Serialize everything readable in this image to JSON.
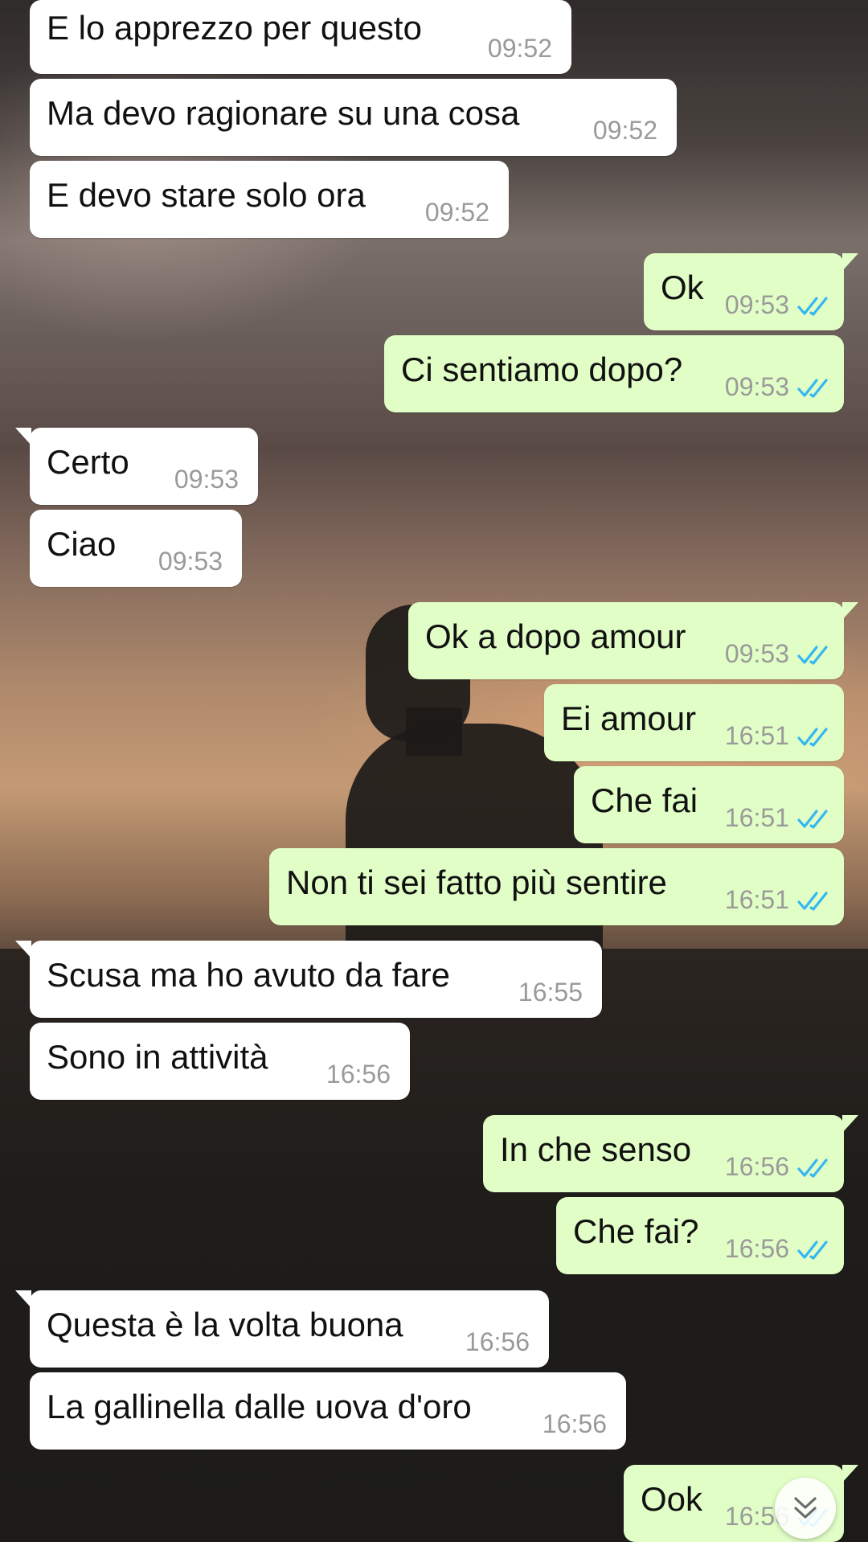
{
  "messages": [
    {
      "direction": "in",
      "text": "E lo apprezzo per questo",
      "time": "09:52"
    },
    {
      "direction": "in",
      "text": "Ma devo ragionare su una cosa",
      "time": "09:52"
    },
    {
      "direction": "in",
      "text": "E devo stare solo ora",
      "time": "09:52"
    },
    {
      "direction": "out",
      "text": "Ok",
      "time": "09:53",
      "status": "read"
    },
    {
      "direction": "out",
      "text": "Ci sentiamo dopo?",
      "time": "09:53",
      "status": "read"
    },
    {
      "direction": "in",
      "text": "Certo",
      "time": "09:53"
    },
    {
      "direction": "in",
      "text": "Ciao",
      "time": "09:53"
    },
    {
      "direction": "out",
      "text": "Ok a dopo amour",
      "time": "09:53",
      "status": "read"
    },
    {
      "direction": "out",
      "text": "Ei amour",
      "time": "16:51",
      "status": "read"
    },
    {
      "direction": "out",
      "text": "Che fai",
      "time": "16:51",
      "status": "read"
    },
    {
      "direction": "out",
      "text": "Non ti sei fatto più sentire",
      "time": "16:51",
      "status": "read"
    },
    {
      "direction": "in",
      "text": "Scusa ma ho avuto da fare",
      "time": "16:55"
    },
    {
      "direction": "in",
      "text": "Sono in attività",
      "time": "16:56"
    },
    {
      "direction": "out",
      "text": "In che senso",
      "time": "16:56",
      "status": "read"
    },
    {
      "direction": "out",
      "text": "Che fai?",
      "time": "16:56",
      "status": "read"
    },
    {
      "direction": "in",
      "text": "Questa è la volta buona",
      "time": "16:56"
    },
    {
      "direction": "in",
      "text": "La gallinella dalle uova d'oro",
      "time": "16:56"
    },
    {
      "direction": "out",
      "text": "Ook",
      "time": "16:56",
      "status": "read"
    }
  ],
  "colors": {
    "incoming_bubble": "#ffffff",
    "outgoing_bubble": "#e1fec6",
    "read_ticks": "#34b7f1",
    "timestamp": "#9a9a9a"
  },
  "icons": {
    "read_receipt": "double-check-icon",
    "scroll_down": "double-chevron-down-icon"
  }
}
